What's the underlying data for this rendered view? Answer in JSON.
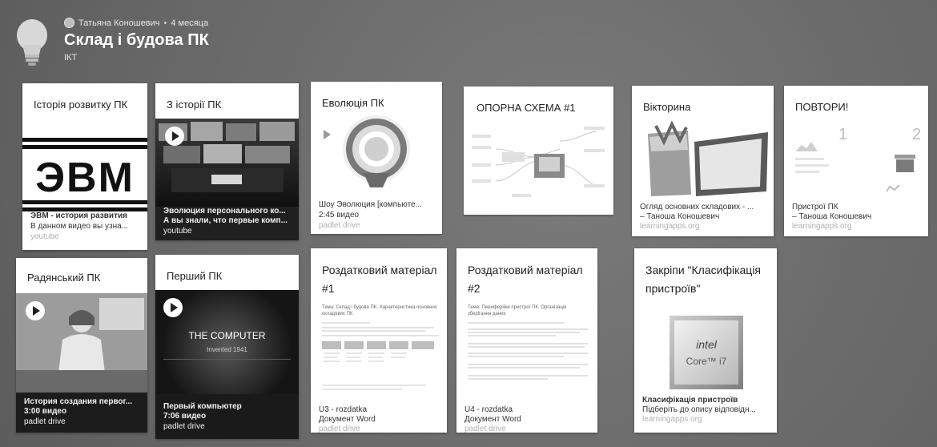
{
  "header": {
    "author": "Татьяна Коношевич",
    "separator": "•",
    "time": "4 месяца",
    "title": "Склад і будова ПК",
    "subtitle": "ІКТ"
  },
  "cards": {
    "c1": {
      "title": "Історія розвитку ПК",
      "media_text": "ЭВМ",
      "line1": "ЭВМ - история развития",
      "line2": "В данном видео вы узна...",
      "line3": "youtube"
    },
    "c2": {
      "title": "З історії ПК",
      "line1": "Эволюция персонального ко...",
      "line2": "А вы знали, что первые комп...",
      "line3": "youtube"
    },
    "c3": {
      "title": "Еволюція ПК",
      "line1": "Шоу Эволюция [компьюте...",
      "line2": "2:45 видео",
      "line3": "padlet drive"
    },
    "c4": {
      "title": "ОПОРНА СХЕМА #1"
    },
    "c5": {
      "title": "Вікторина",
      "line1": "Огляд основних складових - ...",
      "line2": "– Таноша Коношевич",
      "line3": "learningapps.org"
    },
    "c6": {
      "title": "ПОВТОРИ!",
      "num1": "1",
      "num2": "2",
      "line1": "Пристрої ПК",
      "line2": "– Таноша Коношевич",
      "line3": "learningapps.org"
    },
    "c7": {
      "title": "Радянський ПК",
      "line1": "История создания первог...",
      "line2": "3:00 видео",
      "line3": "padlet drive"
    },
    "c8": {
      "title": "Перший ПК",
      "media_title": "THE COMPUTER",
      "media_sub": "Invented 1941",
      "line1": "Первый компьютер",
      "line2": "7:06 видео",
      "line3": "padlet drive"
    },
    "c9": {
      "title": "Роздатковий матеріал #1",
      "doc_head": "Тема: Склад і будова ПК. Характеристика основних складових ПК",
      "line1": "U3 - rozdatka",
      "line2": "Документ Word",
      "line3": "padlet drive"
    },
    "c10": {
      "title": "Роздатковий матеріал #2",
      "doc_head": "Тема: Периферійні пристрої ПК. Організація зберігання даних",
      "line1": "U4 - rozdatka",
      "line2": "Документ Word",
      "line3": "padlet drive"
    },
    "c11": {
      "title": "Закріпи \"Класифікація пристроїв\"",
      "intel": "intel",
      "core": "Core™ i7",
      "line1": "Класифікація пристроїв",
      "line2": "Підберіть до опису відповідн...",
      "line3": "learningapps.org"
    }
  },
  "colors": {
    "board": "#6e6e6e",
    "card": "#ffffff",
    "title": "#ffffff"
  },
  "icons": {
    "logo": "lightbulb-icon",
    "avatar": "avatar-icon",
    "play": "play-icon"
  }
}
